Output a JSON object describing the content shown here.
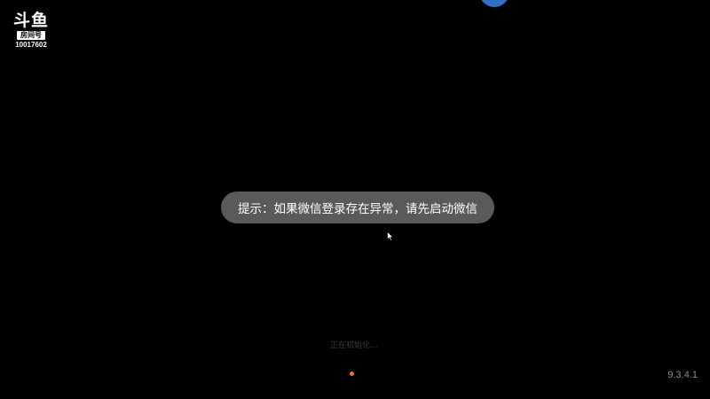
{
  "watermark": {
    "logo": "斗鱼",
    "tag": "房间号",
    "room_number": "10017602"
  },
  "toast": {
    "message": "提示：如果微信登录存在异常，请先启动微信"
  },
  "loading": {
    "text": "正在初始化..."
  },
  "version": "9.3.4.1",
  "colors": {
    "background": "#000000",
    "toast_bg": "#5a5a5a",
    "accent_dot": "#e8772e",
    "top_circle": "#2f6fc4"
  },
  "icons": {
    "cursor": "mouse-pointer-icon",
    "loading": "loading-dot-icon"
  }
}
